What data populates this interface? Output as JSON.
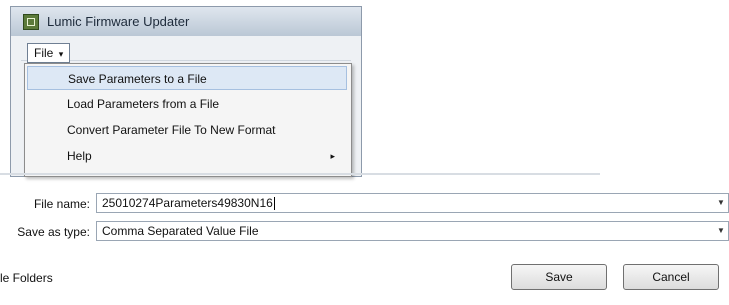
{
  "window": {
    "title": "Lumic Firmware Updater",
    "icon": "app-icon"
  },
  "menubar": {
    "file_label": "File",
    "file_caret": "▾"
  },
  "file_menu": {
    "items": [
      {
        "label": "Save Parameters to a File",
        "highlighted": true
      },
      {
        "label": "Load Parameters from a File"
      },
      {
        "label": "Convert Parameter File To New Format"
      },
      {
        "label": "Help",
        "submenu_arrow": "▸"
      }
    ]
  },
  "save_dialog": {
    "file_name_label": "File name:",
    "file_name_value": "25010274Parameters49830N16",
    "save_as_type_label": "Save as type:",
    "save_as_type_value": "Comma Separated Value File",
    "dropdown_arrow": "▼",
    "folders_label": "le Folders",
    "save_button": "Save",
    "cancel_button": "Cancel"
  }
}
